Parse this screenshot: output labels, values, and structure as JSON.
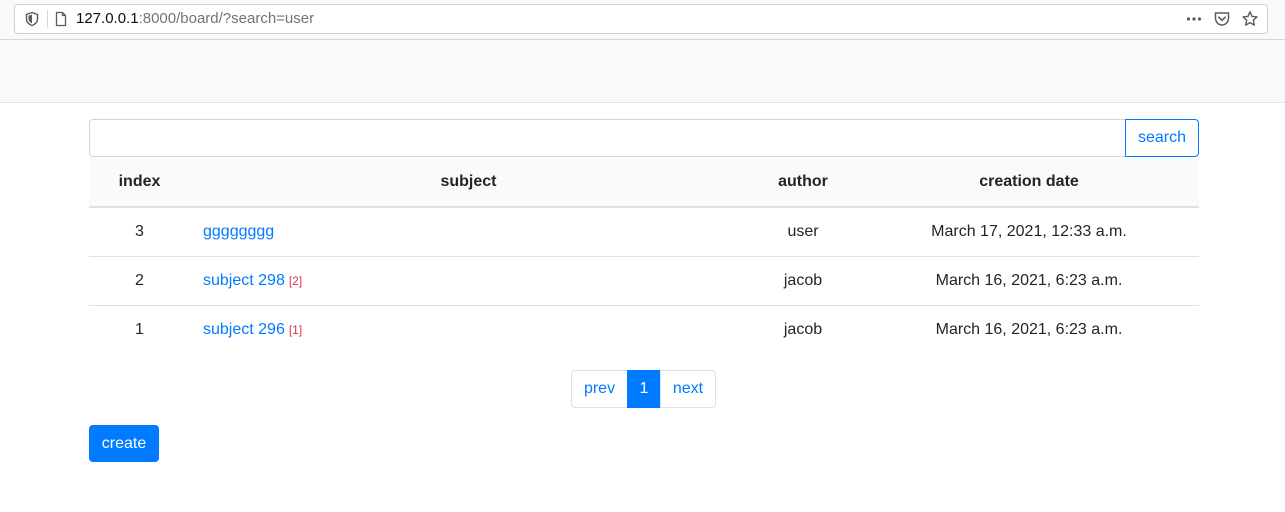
{
  "browser": {
    "url_host": "127.0.0.1",
    "url_rest": ":8000/board/?search=user"
  },
  "search": {
    "value": "",
    "placeholder": "",
    "button_label": "search"
  },
  "table": {
    "headers": [
      "index",
      "subject",
      "author",
      "creation date"
    ],
    "rows": [
      {
        "index": "3",
        "subject": "gggggggg",
        "reply_count": "",
        "author": "user",
        "date": "March 17, 2021, 12:33 a.m."
      },
      {
        "index": "2",
        "subject": "subject 298",
        "reply_count": "[2]",
        "author": "jacob",
        "date": "March 16, 2021, 6:23 a.m."
      },
      {
        "index": "1",
        "subject": "subject 296",
        "reply_count": "[1]",
        "author": "jacob",
        "date": "March 16, 2021, 6:23 a.m."
      }
    ]
  },
  "pagination": {
    "prev_label": "prev",
    "current_page": "1",
    "next_label": "next"
  },
  "create_button_label": "create",
  "colors": {
    "primary": "#007bff",
    "reply_count": "#dc3545",
    "navbar_bg": "#f8f9fa"
  }
}
